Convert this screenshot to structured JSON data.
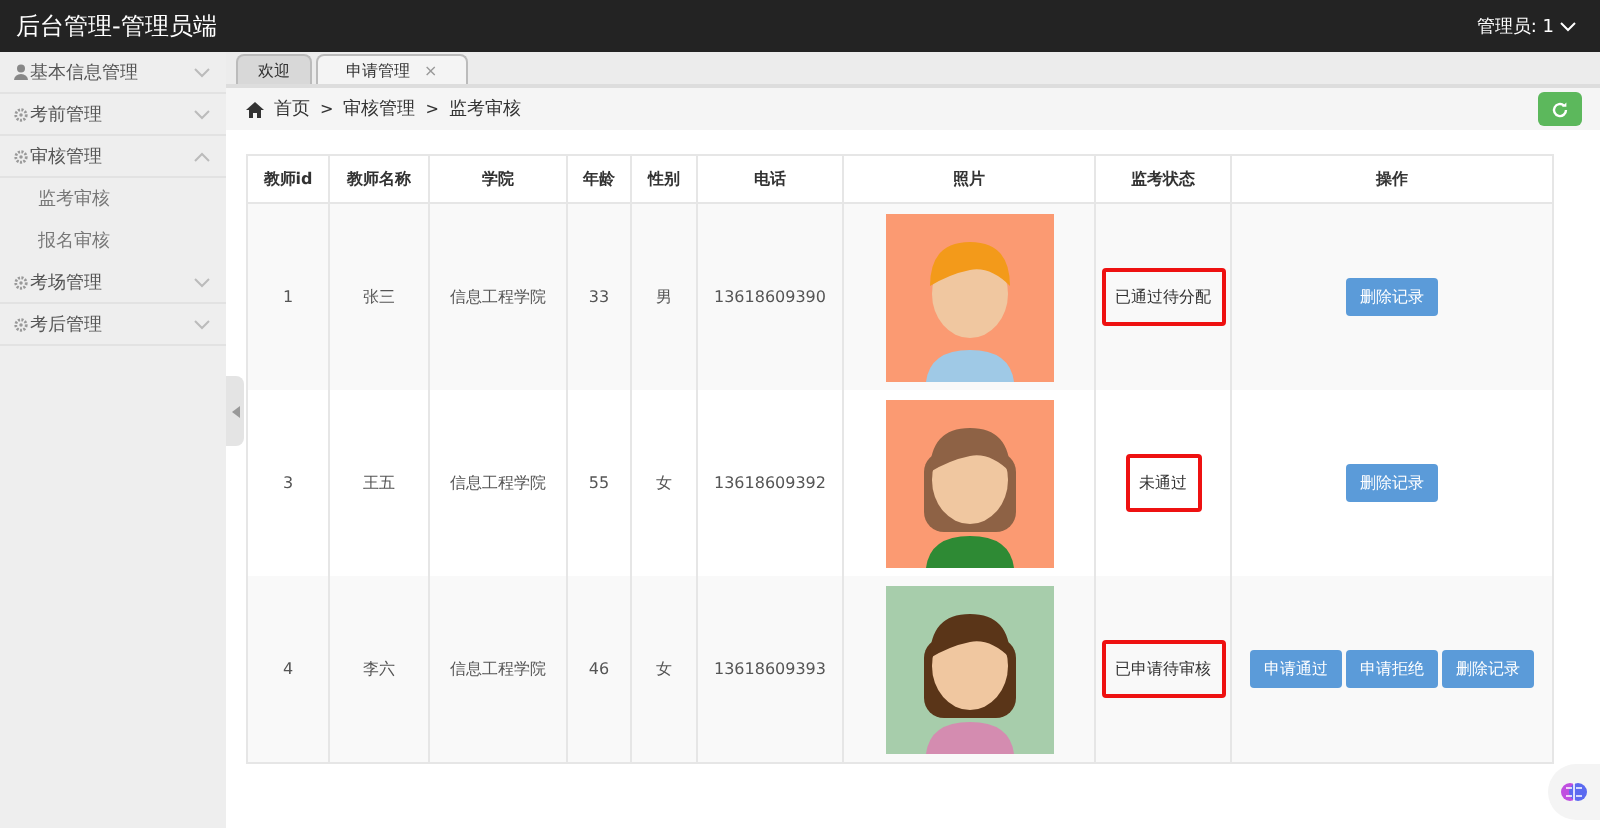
{
  "header": {
    "title": "后台管理-管理员端",
    "user": "管理员: 1"
  },
  "sidebar": {
    "items": [
      {
        "label": "基本信息管理",
        "expanded": false
      },
      {
        "label": "考前管理",
        "expanded": false
      },
      {
        "label": "审核管理",
        "expanded": true,
        "children": [
          {
            "label": "监考审核"
          },
          {
            "label": "报名审核"
          }
        ]
      },
      {
        "label": "考场管理",
        "expanded": false
      },
      {
        "label": "考后管理",
        "expanded": false
      }
    ]
  },
  "tabs": [
    {
      "label": "欢迎",
      "selected": false
    },
    {
      "label": "申请管理",
      "selected": true,
      "close": "×"
    }
  ],
  "breadcrumb": [
    {
      "label": "首页"
    },
    {
      "separator": ">",
      "label": "审核管理"
    },
    {
      "separator": ">",
      "label": "监考审核"
    }
  ],
  "table": {
    "columns": [
      "教师id",
      "教师名称",
      "学院",
      "年龄",
      "性别",
      "电话",
      "照片",
      "监考状态",
      "操作"
    ],
    "rows": [
      {
        "id": "1",
        "name": "张三",
        "college": "信息工程学院",
        "age": "33",
        "sex": "男",
        "phone": "13618609390",
        "photo": {
          "kind": "picture"
        },
        "status": "已通过待分配",
        "highlighted": true,
        "actions": [
          "删除记录"
        ]
      },
      {
        "id": "3",
        "name": "王五",
        "college": "信息工程学院",
        "age": "55",
        "sex": "女",
        "phone": "13618609392",
        "photo": {
          "kind": "picture"
        },
        "status": "未通过",
        "highlighted": true,
        "actions": [
          "删除记录"
        ]
      },
      {
        "id": "4",
        "name": "李六",
        "college": "信息工程学院",
        "age": "46",
        "sex": "女",
        "phone": "13618609393",
        "photo": {
          "kind": "picture"
        },
        "status": "已申请待审核",
        "highlighted": true,
        "actions": [
          "申请通过",
          "申请拒绝",
          "删除记录"
        ]
      }
    ]
  }
}
